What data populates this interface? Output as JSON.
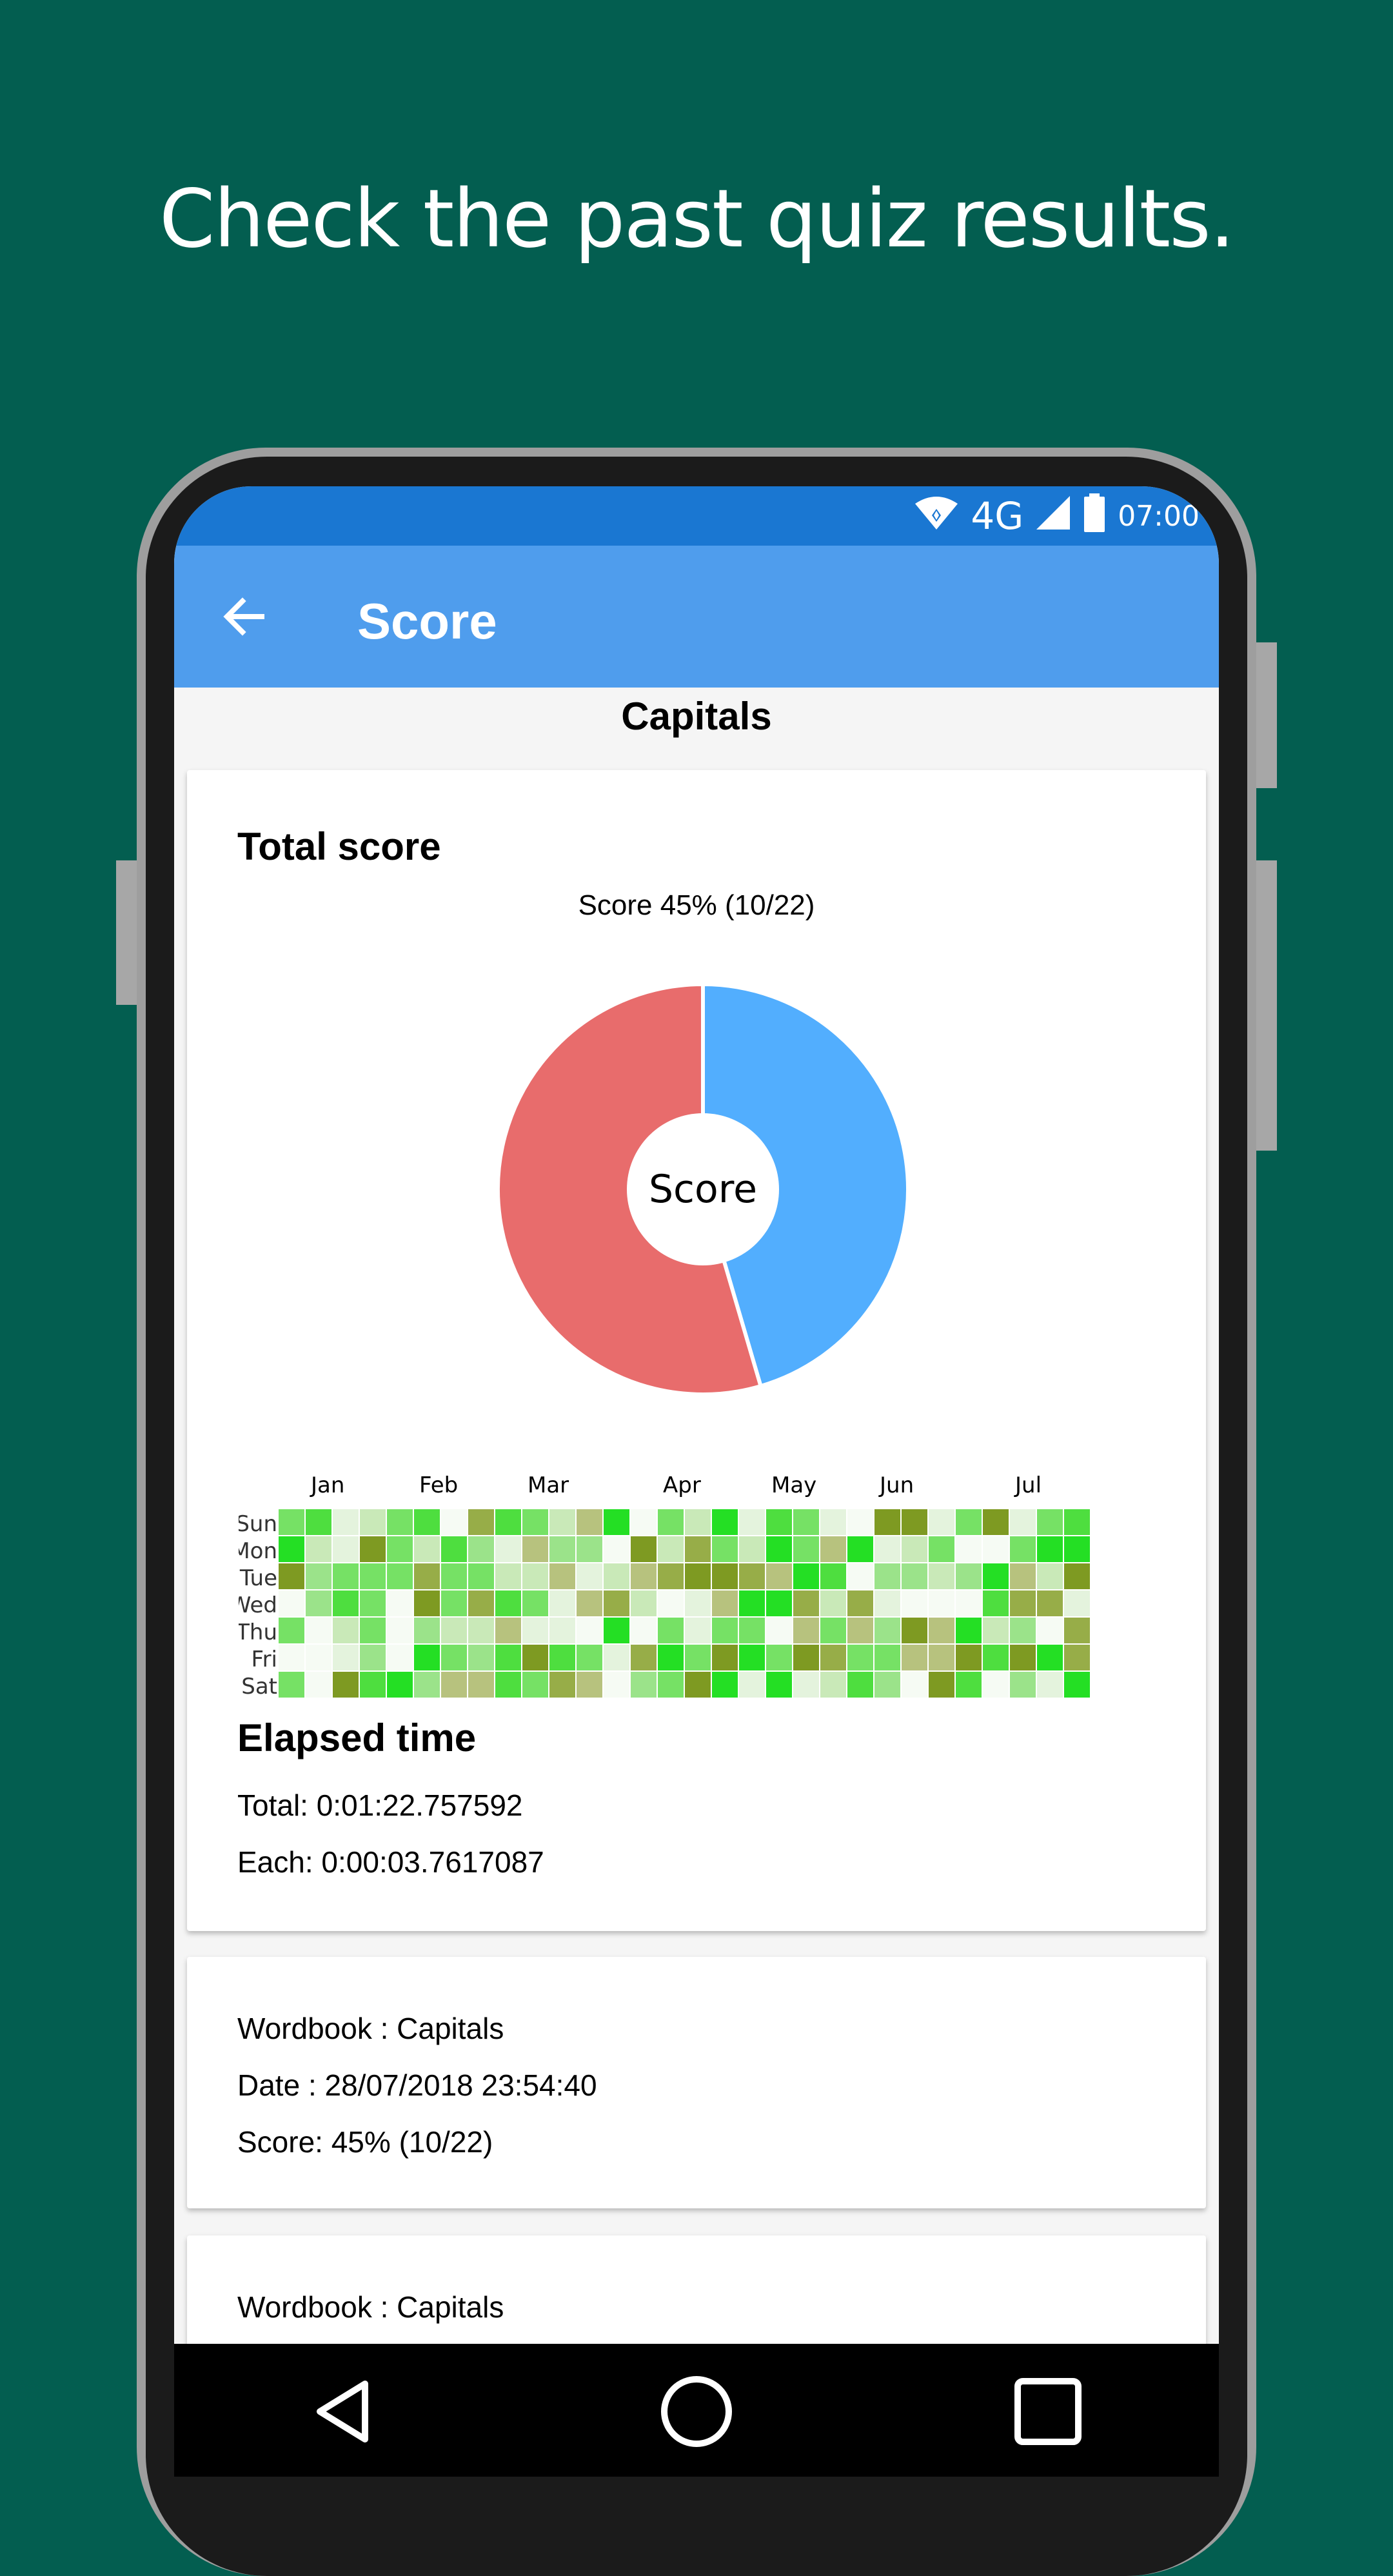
{
  "caption": "Check the past quiz results.",
  "status_bar": {
    "network": "4G",
    "time": "07:00",
    "icons": [
      "wifi-icon",
      "signal-icon",
      "battery-icon"
    ]
  },
  "app_bar": {
    "title": "Score",
    "back_icon": "arrow-back-icon"
  },
  "wordbook_title": "Capitals",
  "score_card": {
    "heading": "Total score",
    "chart_title": "Score 45% (10/22)",
    "donut_center": "Score",
    "elapsed_heading": "Elapsed time",
    "total_time": "Total: 0:01:22.757592",
    "each_time": "Each: 0:00:03.7617087"
  },
  "chart_data": [
    {
      "type": "pie",
      "title": "Score 45% (10/22)",
      "center_label": "Score",
      "slices": [
        {
          "value": 10,
          "color": "#52aefe"
        },
        {
          "value": 12,
          "color": "#e86c6c"
        }
      ]
    },
    {
      "type": "heatmap",
      "months": [
        "Jan",
        "Feb",
        "Mar",
        "Apr",
        "May",
        "Jun",
        "Jul"
      ],
      "days": [
        "Sun",
        "Mon",
        "Tue",
        "Wed",
        "Thu",
        "Fri",
        "Sat"
      ]
    }
  ],
  "history": [
    {
      "wordbook": "Wordbook : Capitals",
      "date": "Date : 28/07/2018 23:54:40",
      "score": "Score: 45% (10/22)"
    },
    {
      "wordbook": "Wordbook : Capitals"
    }
  ],
  "nav_bar": {
    "back_icon": "triangle-back-icon",
    "home_icon": "circle-home-icon",
    "recents_icon": "square-recents-icon"
  },
  "colors": {
    "background": "#035e50",
    "status_bar": "#1a77d2",
    "app_bar": "#4f9ded",
    "correct": "#52aefe",
    "wrong": "#e86c6c"
  }
}
